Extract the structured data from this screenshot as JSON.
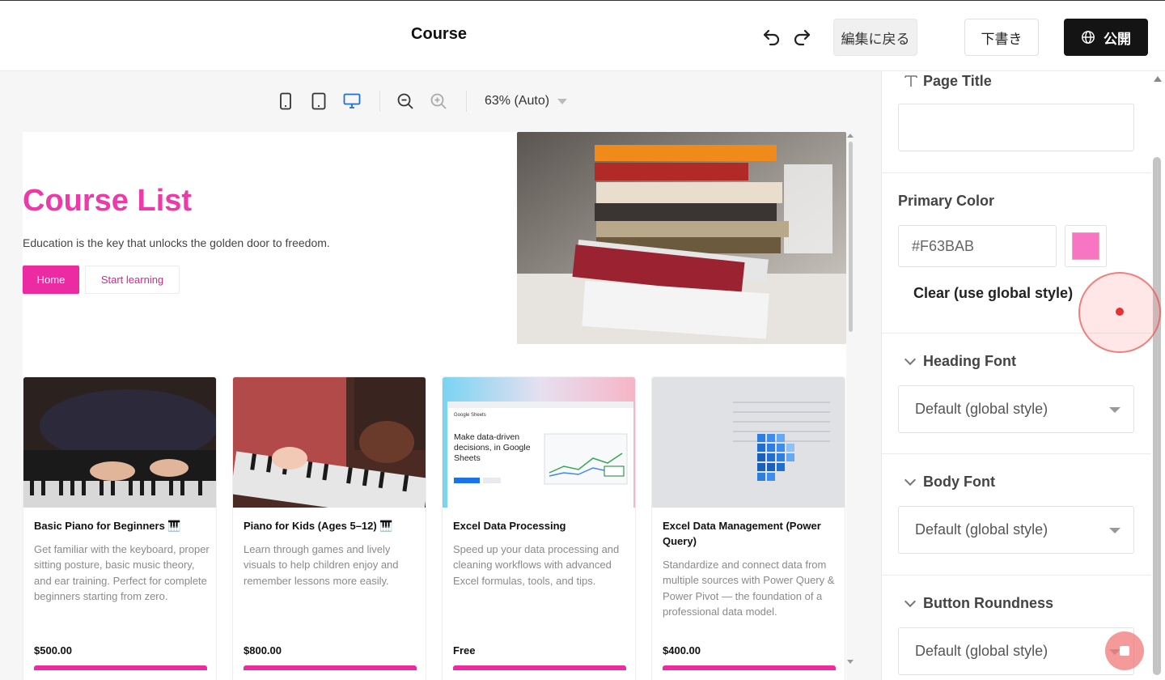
{
  "header": {
    "title": "Course",
    "back_label": "編集に戻る",
    "draft_label": "下書き",
    "publish_label": "公開"
  },
  "toolbar": {
    "zoom_label": "63% (Auto)"
  },
  "page": {
    "hero": {
      "title": "Course List",
      "subtitle": "Education is the key that unlocks the golden door to freedom.",
      "btn_home": "Home",
      "btn_start": "Start learning"
    },
    "courses": [
      {
        "title": "Basic Piano for Beginners 🎹",
        "desc": "Get familiar with the keyboard, proper sitting posture, basic music theory, and ear training. Perfect for complete beginners starting from zero.",
        "price": "$500.00"
      },
      {
        "title": "Piano for Kids (Ages 5–12) 🎹",
        "desc": "Learn through games and lively visuals to help children enjoy and remember lessons more easily.",
        "price": "$800.00"
      },
      {
        "title": "Excel Data Processing",
        "desc": "Speed up your data processing and cleaning workflows with advanced Excel formulas, tools, and tips.",
        "price": "Free"
      },
      {
        "title": "Excel Data Management (Power Query)",
        "desc": "Standardize and connect data from multiple sources with Power Query & Power Pivot — the foundation of a professional data model.",
        "price": "$400.00"
      }
    ],
    "sheets_headline": "Make data-driven decisions, in Google Sheets",
    "sheets_logo": "Google Sheets"
  },
  "panel": {
    "page_title_label": "Page Title",
    "page_title_value": "",
    "primary_color_label": "Primary Color",
    "primary_color_value": "#F63BAB",
    "clear_label": "Clear (use global style)",
    "heading_font_label": "Heading Font",
    "heading_font_value": "Default (global style)",
    "body_font_label": "Body Font",
    "body_font_value": "Default (global style)",
    "button_roundness_label": "Button Roundness",
    "button_roundness_value": "Default (global style)"
  },
  "colors": {
    "accent": "#F63BAB",
    "publish_bg": "#141414"
  },
  "icons": [
    "undo-icon",
    "redo-icon",
    "globe-icon",
    "mobile-icon",
    "tablet-icon",
    "desktop-icon",
    "zoom-out-icon",
    "zoom-in-icon",
    "text-icon",
    "chevron-down-icon"
  ]
}
